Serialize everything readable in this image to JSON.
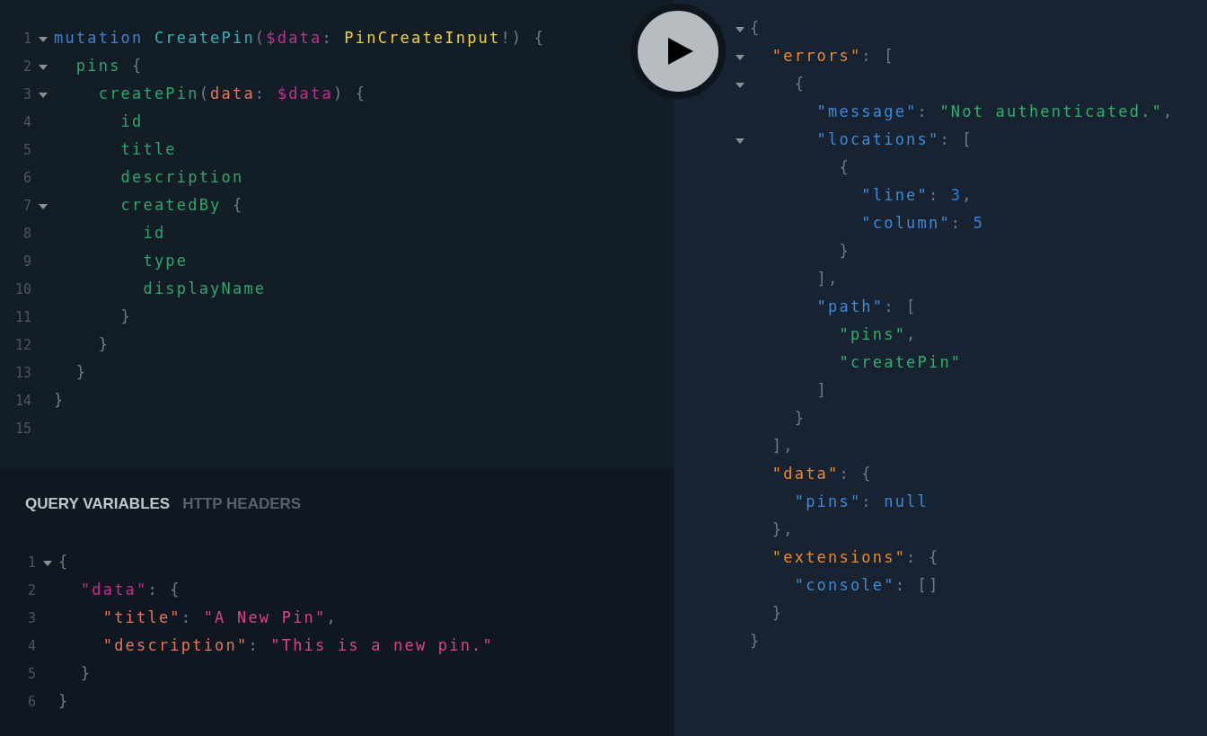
{
  "query_editor": {
    "lines": [
      {
        "number": "1",
        "foldable": true,
        "tokens": [
          {
            "kind": "keyword",
            "text": "mutation "
          },
          {
            "kind": "name",
            "text": "CreatePin"
          },
          {
            "kind": "punct",
            "text": "("
          },
          {
            "kind": "variable",
            "text": "$data"
          },
          {
            "kind": "punct",
            "text": ": "
          },
          {
            "kind": "type",
            "text": "PinCreateInput"
          },
          {
            "kind": "punct",
            "text": "!) {"
          }
        ]
      },
      {
        "number": "2",
        "foldable": true,
        "tokens": [
          {
            "kind": "field",
            "text": "  pins"
          },
          {
            "kind": "punct",
            "text": " {"
          }
        ]
      },
      {
        "number": "3",
        "foldable": true,
        "tokens": [
          {
            "kind": "field",
            "text": "    createPin"
          },
          {
            "kind": "punct",
            "text": "("
          },
          {
            "kind": "argument",
            "text": "data"
          },
          {
            "kind": "punct",
            "text": ": "
          },
          {
            "kind": "variable",
            "text": "$data"
          },
          {
            "kind": "punct",
            "text": ") {"
          }
        ]
      },
      {
        "number": "4",
        "foldable": false,
        "tokens": [
          {
            "kind": "field",
            "text": "      id"
          }
        ]
      },
      {
        "number": "5",
        "foldable": false,
        "tokens": [
          {
            "kind": "field",
            "text": "      title"
          }
        ]
      },
      {
        "number": "6",
        "foldable": false,
        "tokens": [
          {
            "kind": "field",
            "text": "      description"
          }
        ]
      },
      {
        "number": "7",
        "foldable": true,
        "tokens": [
          {
            "kind": "field",
            "text": "      createdBy"
          },
          {
            "kind": "punct",
            "text": " {"
          }
        ]
      },
      {
        "number": "8",
        "foldable": false,
        "tokens": [
          {
            "kind": "field",
            "text": "        id"
          }
        ]
      },
      {
        "number": "9",
        "foldable": false,
        "tokens": [
          {
            "kind": "field",
            "text": "        type"
          }
        ]
      },
      {
        "number": "10",
        "foldable": false,
        "tokens": [
          {
            "kind": "field",
            "text": "        displayName"
          }
        ]
      },
      {
        "number": "11",
        "foldable": false,
        "tokens": [
          {
            "kind": "punct",
            "text": "      }"
          }
        ]
      },
      {
        "number": "12",
        "foldable": false,
        "tokens": [
          {
            "kind": "punct",
            "text": "    }"
          }
        ]
      },
      {
        "number": "13",
        "foldable": false,
        "tokens": [
          {
            "kind": "punct",
            "text": "  }"
          }
        ]
      },
      {
        "number": "14",
        "foldable": false,
        "tokens": [
          {
            "kind": "punct",
            "text": "}"
          }
        ]
      },
      {
        "number": "15",
        "foldable": false
      }
    ]
  },
  "variables_panel": {
    "tabs": [
      {
        "label": "QUERY VARIABLES",
        "selected": true
      },
      {
        "label": "HTTP HEADERS",
        "selected": false
      }
    ],
    "lines": [
      {
        "number": "1",
        "foldable": true,
        "tokens": [
          {
            "kind": "punct",
            "text": "{"
          }
        ]
      },
      {
        "number": "2",
        "foldable": false,
        "tokens": [
          {
            "kind": "key",
            "text": "  \"data\""
          },
          {
            "kind": "punct",
            "text": ": {"
          }
        ]
      },
      {
        "number": "3",
        "foldable": false,
        "tokens": [
          {
            "kind": "argument",
            "text": "    \"title\""
          },
          {
            "kind": "punct",
            "text": ": "
          },
          {
            "kind": "string",
            "text": "\"A New Pin\""
          },
          {
            "kind": "punct",
            "text": ","
          }
        ]
      },
      {
        "number": "4",
        "foldable": false,
        "tokens": [
          {
            "kind": "argument",
            "text": "    \"description\""
          },
          {
            "kind": "punct",
            "text": ": "
          },
          {
            "kind": "string",
            "text": "\"This is a new pin.\""
          }
        ]
      },
      {
        "number": "5",
        "foldable": false,
        "tokens": [
          {
            "kind": "punct",
            "text": "  }"
          }
        ]
      },
      {
        "number": "6",
        "foldable": false,
        "tokens": [
          {
            "kind": "punct",
            "text": "}"
          }
        ]
      }
    ]
  },
  "result_panel": {
    "lines": [
      {
        "foldable": true,
        "tokens": [
          {
            "kind": "punct",
            "text": "{"
          }
        ]
      },
      {
        "foldable": true,
        "tokens": [
          {
            "kind": "result-key",
            "text": "  \"errors\""
          },
          {
            "kind": "punct",
            "text": ": ["
          }
        ]
      },
      {
        "foldable": true,
        "tokens": [
          {
            "kind": "punct",
            "text": "    {"
          }
        ]
      },
      {
        "foldable": false,
        "tokens": [
          {
            "kind": "result-prop",
            "text": "      \"message\""
          },
          {
            "kind": "punct",
            "text": ": "
          },
          {
            "kind": "result-string",
            "text": "\"Not authenticated.\""
          },
          {
            "kind": "punct",
            "text": ","
          }
        ]
      },
      {
        "foldable": true,
        "tokens": [
          {
            "kind": "result-prop",
            "text": "      \"locations\""
          },
          {
            "kind": "punct",
            "text": ": ["
          }
        ]
      },
      {
        "foldable": false,
        "tokens": [
          {
            "kind": "punct",
            "text": "        {"
          }
        ]
      },
      {
        "foldable": false,
        "tokens": [
          {
            "kind": "result-prop",
            "text": "          \"line\""
          },
          {
            "kind": "punct",
            "text": ": "
          },
          {
            "kind": "number",
            "text": "3"
          },
          {
            "kind": "punct",
            "text": ","
          }
        ]
      },
      {
        "foldable": false,
        "tokens": [
          {
            "kind": "result-prop",
            "text": "          \"column\""
          },
          {
            "kind": "punct",
            "text": ": "
          },
          {
            "kind": "number",
            "text": "5"
          }
        ]
      },
      {
        "foldable": false,
        "tokens": [
          {
            "kind": "punct",
            "text": "        }"
          }
        ]
      },
      {
        "foldable": false,
        "tokens": [
          {
            "kind": "punct",
            "text": "      ],"
          }
        ]
      },
      {
        "foldable": false,
        "tokens": [
          {
            "kind": "result-prop",
            "text": "      \"path\""
          },
          {
            "kind": "punct",
            "text": ": ["
          }
        ]
      },
      {
        "foldable": false,
        "tokens": [
          {
            "kind": "result-string",
            "text": "        \"pins\""
          },
          {
            "kind": "punct",
            "text": ","
          }
        ]
      },
      {
        "foldable": false,
        "tokens": [
          {
            "kind": "result-string",
            "text": "        \"createPin\""
          }
        ]
      },
      {
        "foldable": false,
        "tokens": [
          {
            "kind": "punct",
            "text": "      ]"
          }
        ]
      },
      {
        "foldable": false,
        "tokens": [
          {
            "kind": "punct",
            "text": "    }"
          }
        ]
      },
      {
        "foldable": false,
        "tokens": [
          {
            "kind": "punct",
            "text": "  ],"
          }
        ]
      },
      {
        "foldable": false,
        "tokens": [
          {
            "kind": "result-key",
            "text": "  \"data\""
          },
          {
            "kind": "punct",
            "text": ": {"
          }
        ]
      },
      {
        "foldable": false,
        "tokens": [
          {
            "kind": "result-prop",
            "text": "    \"pins\""
          },
          {
            "kind": "punct",
            "text": ": "
          },
          {
            "kind": "null",
            "text": "null"
          }
        ]
      },
      {
        "foldable": false,
        "tokens": [
          {
            "kind": "punct",
            "text": "  },"
          }
        ]
      },
      {
        "foldable": false,
        "tokens": [
          {
            "kind": "result-key",
            "text": "  \"extensions\""
          },
          {
            "kind": "punct",
            "text": ": {"
          }
        ]
      },
      {
        "foldable": false,
        "tokens": [
          {
            "kind": "result-prop",
            "text": "    \"console\""
          },
          {
            "kind": "punct",
            "text": ": []"
          }
        ]
      },
      {
        "foldable": false,
        "tokens": [
          {
            "kind": "punct",
            "text": "  }"
          }
        ]
      },
      {
        "foldable": false,
        "tokens": [
          {
            "kind": "punct",
            "text": "}"
          }
        ]
      }
    ]
  }
}
